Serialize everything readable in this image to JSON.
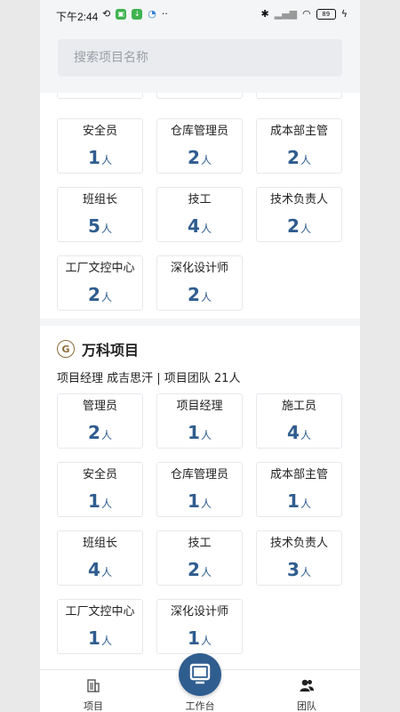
{
  "status_bar": {
    "time": "下午2:44",
    "battery": "89"
  },
  "search": {
    "placeholder": "搜索项目名称"
  },
  "project1": {
    "tiles": [
      {
        "label": "安全员",
        "count": "1",
        "unit": "人"
      },
      {
        "label": "仓库管理员",
        "count": "2",
        "unit": "人"
      },
      {
        "label": "成本部主管",
        "count": "2",
        "unit": "人"
      },
      {
        "label": "班组长",
        "count": "5",
        "unit": "人"
      },
      {
        "label": "技工",
        "count": "4",
        "unit": "人"
      },
      {
        "label": "技术负责人",
        "count": "2",
        "unit": "人"
      },
      {
        "label": "工厂文控中心",
        "count": "2",
        "unit": "人"
      },
      {
        "label": "深化设计师",
        "count": "2",
        "unit": "人"
      }
    ]
  },
  "project2": {
    "logo_letter": "G",
    "title": "万科项目",
    "meta": "项目经理 成吉思汗 | 项目团队 21人",
    "tiles": [
      {
        "label": "管理员",
        "count": "2",
        "unit": "人"
      },
      {
        "label": "项目经理",
        "count": "1",
        "unit": "人"
      },
      {
        "label": "施工员",
        "count": "4",
        "unit": "人"
      },
      {
        "label": "安全员",
        "count": "1",
        "unit": "人"
      },
      {
        "label": "仓库管理员",
        "count": "1",
        "unit": "人"
      },
      {
        "label": "成本部主管",
        "count": "1",
        "unit": "人"
      },
      {
        "label": "班组长",
        "count": "4",
        "unit": "人"
      },
      {
        "label": "技工",
        "count": "2",
        "unit": "人"
      },
      {
        "label": "技术负责人",
        "count": "3",
        "unit": "人"
      },
      {
        "label": "工厂文控中心",
        "count": "1",
        "unit": "人"
      },
      {
        "label": "深化设计师",
        "count": "1",
        "unit": "人"
      }
    ]
  },
  "bottom_nav": {
    "items": [
      {
        "label": "项目",
        "icon": "building-icon"
      },
      {
        "label": "工作台",
        "icon": "monitor-icon"
      },
      {
        "label": "团队",
        "icon": "team-icon"
      }
    ]
  },
  "colors": {
    "accent": "#2f5d8f",
    "background": "#f4f5f7"
  }
}
